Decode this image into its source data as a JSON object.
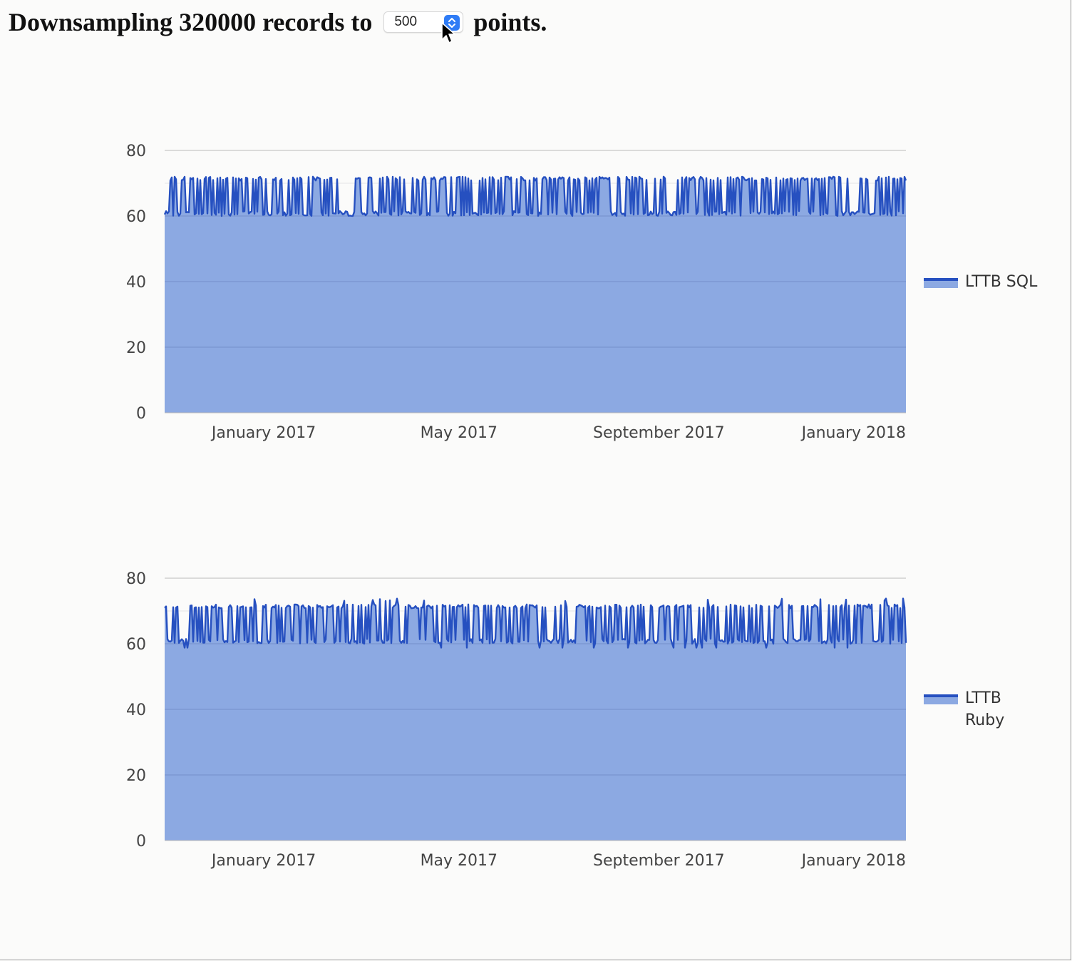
{
  "header": {
    "prefix": "Downsampling 320000 records to",
    "select_value": "500",
    "suffix": "points."
  },
  "colors": {
    "line": "#2650c0",
    "fill": "#8ca9e2",
    "grid": "#c8c8c8",
    "axis_text": "#444444"
  },
  "chart_data": [
    {
      "type": "area",
      "series": [
        {
          "name": "LTTB SQL",
          "y_band": [
            60,
            72
          ]
        }
      ],
      "x_ticks": [
        "January 2017",
        "May 2017",
        "September 2017",
        "January 2018"
      ],
      "y_ticks": [
        0,
        20,
        40,
        60,
        80
      ],
      "ylim": [
        0,
        80
      ],
      "xlim": [
        "2016-11-01",
        "2018-01-31"
      ],
      "grid": true,
      "legend_position": "right"
    },
    {
      "type": "area",
      "series": [
        {
          "name": "LTTB Ruby",
          "y_band": [
            60,
            72
          ]
        }
      ],
      "x_ticks": [
        "January 2017",
        "May 2017",
        "September 2017",
        "January 2018"
      ],
      "y_ticks": [
        0,
        20,
        40,
        60,
        80
      ],
      "ylim": [
        0,
        80
      ],
      "xlim": [
        "2016-11-01",
        "2018-01-31"
      ],
      "grid": true,
      "legend_position": "right"
    }
  ]
}
